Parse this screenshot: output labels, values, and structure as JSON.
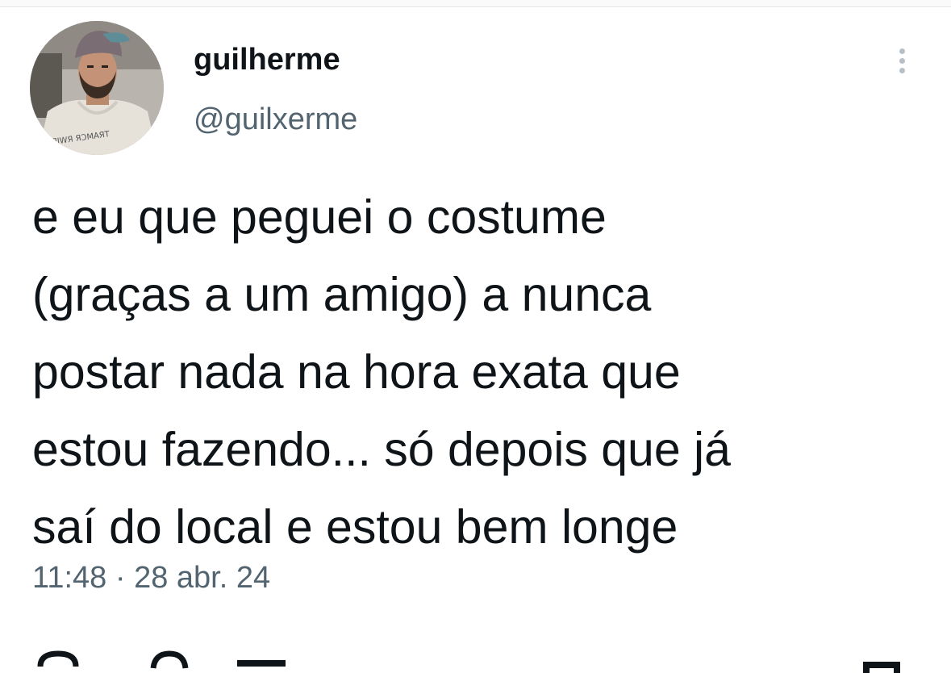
{
  "user": {
    "display_name": "guilherme",
    "handle": "@guilxerme",
    "avatar_shirt_text": "ꟻIWЯ ЯƆMAЯT"
  },
  "tweet": {
    "lines": [
      "e eu que peguei o costume",
      "(graças a um amigo) a nunca",
      "postar nada na hora exata que",
      "estou fazendo... só depois que já",
      "saí do local e estou bem longe"
    ],
    "time": "11:48",
    "separator": "·",
    "date": "28 abr. 24"
  },
  "actions": {
    "icons": [
      "reply-icon",
      "retweet-icon",
      "like-icon",
      "share-icon"
    ]
  },
  "colors": {
    "text_primary": "#0f1419",
    "text_secondary": "#536471",
    "background": "#ffffff"
  }
}
